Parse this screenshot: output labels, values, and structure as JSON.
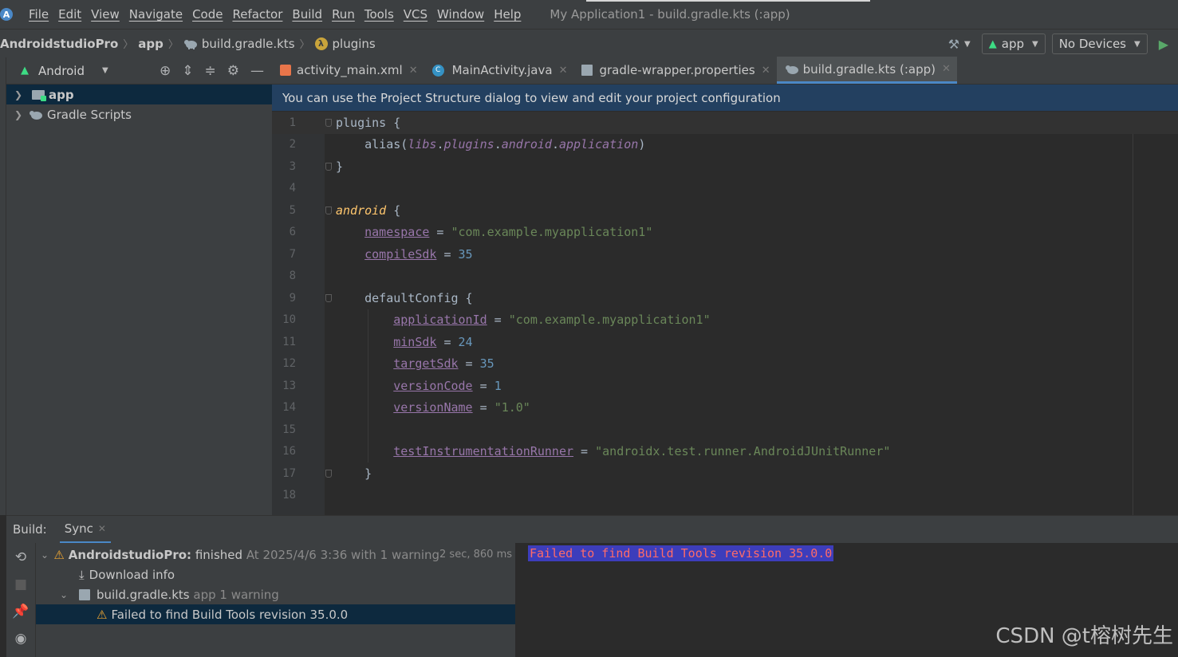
{
  "menubar": {
    "items": [
      "File",
      "Edit",
      "View",
      "Navigate",
      "Code",
      "Refactor",
      "Build",
      "Run",
      "Tools",
      "VCS",
      "Window",
      "Help"
    ],
    "window_title": "My Application1 - build.gradle.kts (:app)"
  },
  "navbar": {
    "breadcrumbs": [
      "AndroidstudioPro",
      "app",
      "build.gradle.kts",
      "plugins"
    ],
    "run_config": "app",
    "device": "No Devices"
  },
  "project_panel": {
    "view_mode": "Android",
    "tree": [
      {
        "label": "app",
        "selected": true
      },
      {
        "label": "Gradle Scripts",
        "selected": false
      }
    ]
  },
  "editor": {
    "tabs": [
      {
        "label": "activity_main.xml",
        "active": false
      },
      {
        "label": "MainActivity.java",
        "active": false
      },
      {
        "label": "gradle-wrapper.properties",
        "active": false
      },
      {
        "label": "build.gradle.kts (:app)",
        "active": true
      }
    ],
    "banner": "You can use the Project Structure dialog to view and edit your project configuration",
    "lines": [
      {
        "n": "1",
        "tokens": [
          [
            "plain",
            "plugins {"
          ]
        ]
      },
      {
        "n": "2",
        "tokens": [
          [
            "plain",
            "    alias("
          ],
          [
            "it",
            "libs"
          ],
          [
            "plain",
            "."
          ],
          [
            "it",
            "plugins"
          ],
          [
            "plain",
            "."
          ],
          [
            "it",
            "android"
          ],
          [
            "plain",
            "."
          ],
          [
            "it",
            "application"
          ],
          [
            "plain",
            ")"
          ]
        ]
      },
      {
        "n": "3",
        "tokens": [
          [
            "plain",
            "}"
          ]
        ]
      },
      {
        "n": "4",
        "tokens": []
      },
      {
        "n": "5",
        "tokens": [
          [
            "fn",
            "android"
          ],
          [
            "plain",
            " {"
          ]
        ]
      },
      {
        "n": "6",
        "tokens": [
          [
            "plain",
            "    "
          ],
          [
            "prop",
            "namespace"
          ],
          [
            "plain",
            " = "
          ],
          [
            "str",
            "\"com.example.myapplication1\""
          ]
        ]
      },
      {
        "n": "7",
        "tokens": [
          [
            "plain",
            "    "
          ],
          [
            "prop",
            "compileSdk"
          ],
          [
            "plain",
            " = "
          ],
          [
            "num",
            "35"
          ]
        ]
      },
      {
        "n": "8",
        "tokens": []
      },
      {
        "n": "9",
        "tokens": [
          [
            "plain",
            "    defaultConfig {"
          ]
        ]
      },
      {
        "n": "10",
        "tokens": [
          [
            "plain",
            "        "
          ],
          [
            "prop",
            "applicationId"
          ],
          [
            "plain",
            " = "
          ],
          [
            "str",
            "\"com.example.myapplication1\""
          ]
        ]
      },
      {
        "n": "11",
        "tokens": [
          [
            "plain",
            "        "
          ],
          [
            "prop",
            "minSdk"
          ],
          [
            "plain",
            " = "
          ],
          [
            "num",
            "24"
          ]
        ]
      },
      {
        "n": "12",
        "tokens": [
          [
            "plain",
            "        "
          ],
          [
            "prop",
            "targetSdk"
          ],
          [
            "plain",
            " = "
          ],
          [
            "num",
            "35"
          ]
        ]
      },
      {
        "n": "13",
        "tokens": [
          [
            "plain",
            "        "
          ],
          [
            "prop",
            "versionCode"
          ],
          [
            "plain",
            " = "
          ],
          [
            "num",
            "1"
          ]
        ]
      },
      {
        "n": "14",
        "tokens": [
          [
            "plain",
            "        "
          ],
          [
            "prop",
            "versionName"
          ],
          [
            "plain",
            " = "
          ],
          [
            "str",
            "\"1.0\""
          ]
        ]
      },
      {
        "n": "15",
        "tokens": []
      },
      {
        "n": "16",
        "tokens": [
          [
            "plain",
            "        "
          ],
          [
            "prop",
            "testInstrumentationRunner"
          ],
          [
            "plain",
            " = "
          ],
          [
            "str",
            "\"androidx.test.runner.AndroidJUnitRunner\""
          ]
        ]
      },
      {
        "n": "17",
        "tokens": [
          [
            "plain",
            "    }"
          ]
        ]
      },
      {
        "n": "18",
        "tokens": []
      }
    ]
  },
  "build": {
    "label": "Build:",
    "tab": "Sync",
    "tree": {
      "root": {
        "project": "AndroidstudioPro:",
        "status": "finished",
        "detail": "At 2025/4/6 3:36 with 1 warning",
        "time": "2 sec, 860 ms"
      },
      "download": "Download info",
      "file": {
        "name": "build.gradle.kts",
        "detail": "app 1 warning"
      },
      "warning": "Failed to find Build Tools revision 35.0.0"
    },
    "console_error": "Failed to find Build Tools revision 35.0.0"
  },
  "watermark": "CSDN @t榕树先生",
  "colors": {
    "accent": "#4a88c7",
    "warning": "#f0a732",
    "error": "#ff6b68",
    "android_green": "#3ddc84"
  }
}
